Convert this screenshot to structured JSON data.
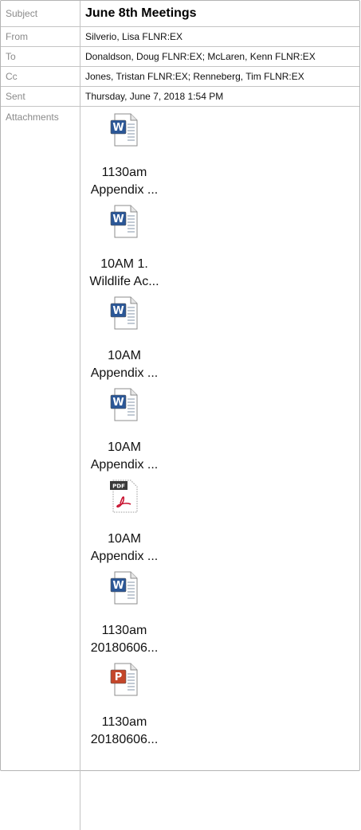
{
  "header": {
    "subject_label": "Subject",
    "subject_value": "June 8th Meetings",
    "from_label": "From",
    "from_value": "Silverio, Lisa FLNR:EX",
    "to_label": "To",
    "to_value": "Donaldson, Doug FLNR:EX; McLaren, Kenn FLNR:EX",
    "cc_label": "Cc",
    "cc_value": "Jones, Tristan FLNR:EX; Renneberg, Tim FLNR:EX",
    "sent_label": "Sent",
    "sent_value": "Thursday, June 7, 2018 1:54 PM",
    "attachments_label": "Attachments"
  },
  "attachments": [
    {
      "icon": "word-doc-icon",
      "line1": "1130am",
      "line2": "Appendix ..."
    },
    {
      "icon": "word-doc-icon",
      "line1": "10AM 1.",
      "line2": "Wildlife Ac..."
    },
    {
      "icon": "word-doc-icon",
      "line1": "10AM",
      "line2": "Appendix ..."
    },
    {
      "icon": "word-doc-icon",
      "line1": "10AM",
      "line2": "Appendix ..."
    },
    {
      "icon": "pdf-doc-icon",
      "icon_text": "PDF",
      "line1": "10AM",
      "line2": "Appendix ..."
    },
    {
      "icon": "word-doc-icon",
      "line1": "1130am",
      "line2": "20180606..."
    },
    {
      "icon": "powerpoint-doc-icon",
      "line1": "1130am",
      "line2": "20180606..."
    }
  ],
  "colors": {
    "word_blue": "#2b5797",
    "ppt_orange": "#c4462a",
    "pdf_red": "#c8102e",
    "label_gray": "#8a8a8a",
    "border_gray": "#c4c4c4"
  }
}
